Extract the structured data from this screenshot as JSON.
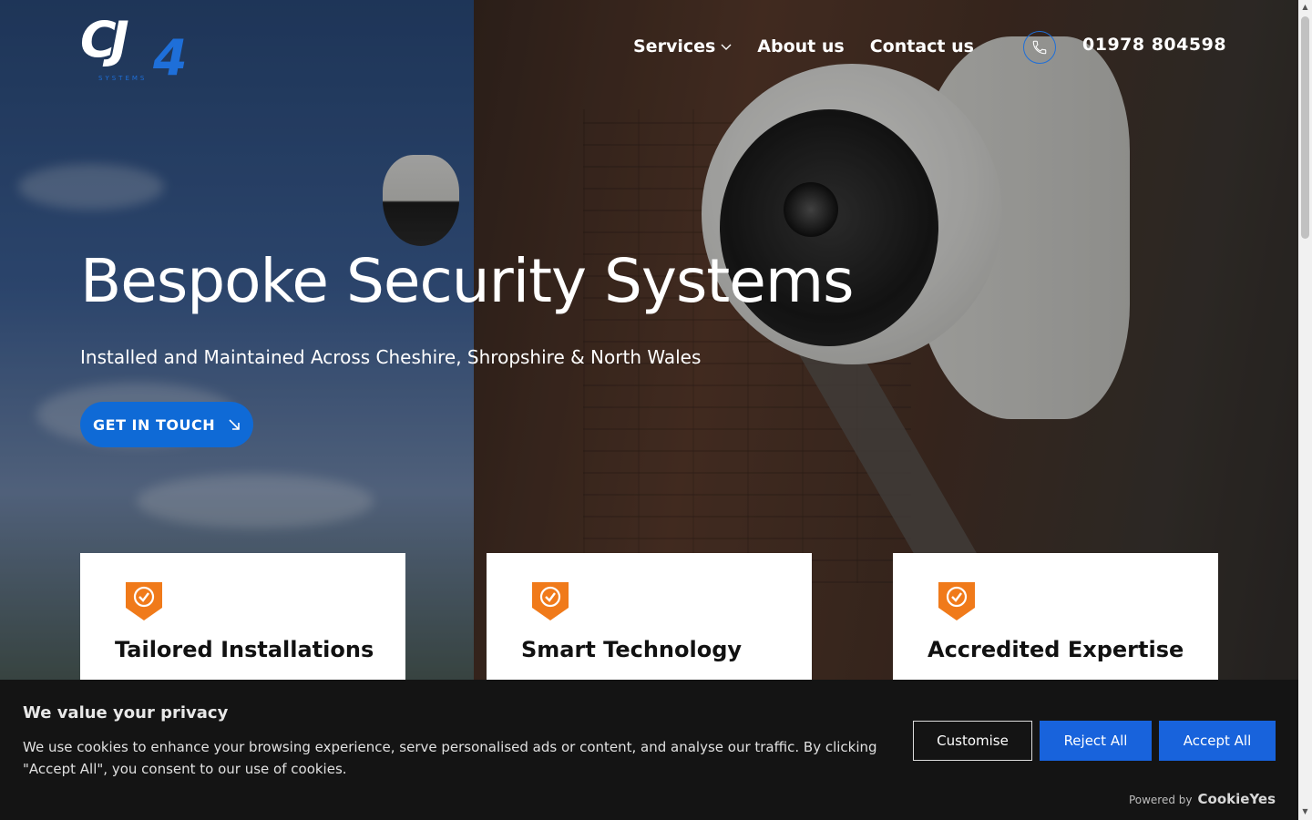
{
  "brand": {
    "logo_alt": "CJ4 Systems",
    "logo_text": "CJ4",
    "logo_sub": "SYSTEMS"
  },
  "nav": {
    "items": [
      {
        "label": "Services",
        "has_dropdown": true
      },
      {
        "label": "About us",
        "has_dropdown": false
      },
      {
        "label": "Contact us",
        "has_dropdown": false
      }
    ],
    "phone": "01978 804598"
  },
  "hero": {
    "title": "Bespoke Security Systems",
    "subtitle": "Installed and Maintained Across Cheshire, Shropshire & North Wales",
    "cta_label": "GET IN TOUCH"
  },
  "features": [
    {
      "title": "Tailored Installations"
    },
    {
      "title": "Smart Technology"
    },
    {
      "title": "Accredited Expertise"
    }
  ],
  "cookie_banner": {
    "title": "We value your privacy",
    "text": "We use cookies to enhance your browsing experience, serve personalised ads or content, and analyse our traffic. By clicking \"Accept All\", you consent to our use of cookies.",
    "customise_label": "Customise",
    "reject_label": "Reject All",
    "accept_label": "Accept All",
    "powered_by": "Powered by",
    "powered_brand": "CookieYes"
  },
  "colors": {
    "accent_blue": "#0f6ad6",
    "button_blue": "#1863dc",
    "badge_orange": "#f07a1a",
    "banner_bg": "#141414"
  }
}
